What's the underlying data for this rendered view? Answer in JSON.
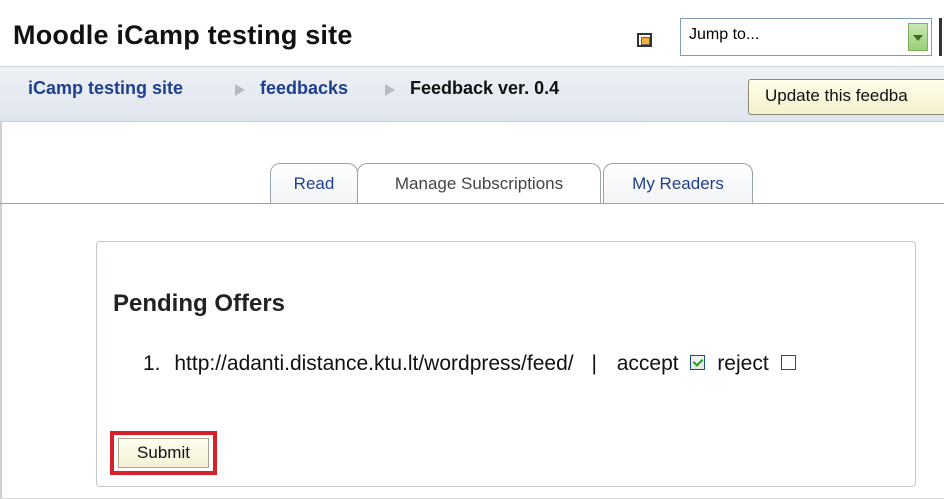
{
  "header": {
    "site_title": "Moodle iCamp testing site",
    "jump_select": {
      "selected": "Jump to..."
    }
  },
  "breadcrumb": {
    "items": [
      {
        "label": "iCamp testing site",
        "link": true
      },
      {
        "label": "feedbacks",
        "link": true
      },
      {
        "label": "Feedback ver. 0.4",
        "link": false
      }
    ],
    "update_button": "Update this feedba"
  },
  "tabs": [
    {
      "label": "Read",
      "active": false
    },
    {
      "label": "Manage Subscriptions",
      "active": true
    },
    {
      "label": "My Readers",
      "active": false
    }
  ],
  "pending": {
    "title": "Pending Offers",
    "offers": [
      {
        "number": "1.",
        "url": "http://adanti.distance.ktu.lt/wordpress/feed/",
        "separator": "|",
        "accept_label": "accept",
        "accept_checked": true,
        "reject_label": "reject",
        "reject_checked": false
      }
    ],
    "submit_label": "Submit"
  },
  "colors": {
    "link": "#1f3f8f",
    "highlight": "#d8202a"
  }
}
